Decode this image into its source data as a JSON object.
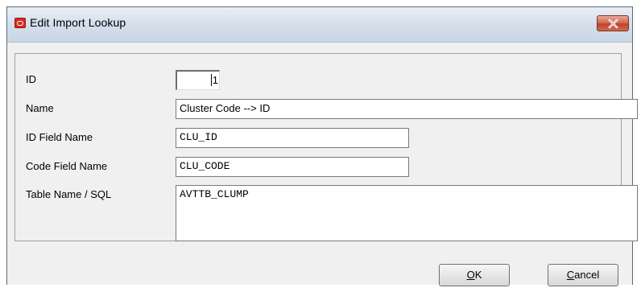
{
  "window": {
    "title": "Edit Import Lookup",
    "close_icon": "close-x-icon",
    "app_icon": "oracle-logo-icon"
  },
  "form": {
    "id": {
      "label": "ID",
      "value": "1"
    },
    "name": {
      "label": "Name",
      "value": "Cluster Code --> ID"
    },
    "id_field_name": {
      "label": "ID Field Name",
      "value": "CLU_ID"
    },
    "code_field_name": {
      "label": "Code Field Name",
      "value": "CLU_CODE"
    },
    "table_name_sql": {
      "label": "Table Name / SQL",
      "value": "AVTTB_CLUMP"
    }
  },
  "buttons": {
    "ok": {
      "mnemonic": "O",
      "rest": "K"
    },
    "cancel": {
      "mnemonic": "C",
      "rest": "ancel"
    }
  }
}
